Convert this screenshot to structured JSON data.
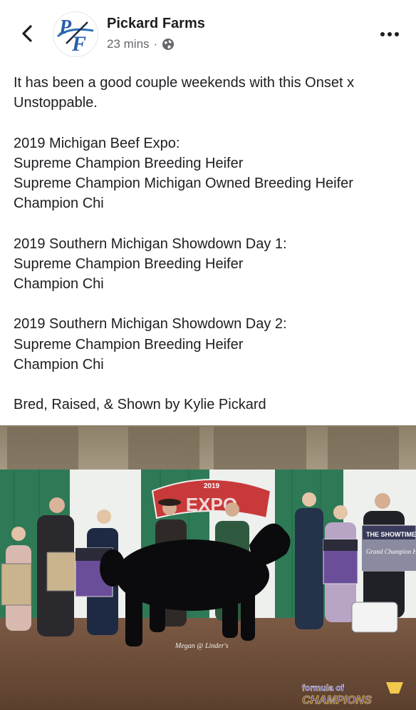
{
  "header": {
    "page_name": "Pickard Farms",
    "time_ago": "23 mins",
    "separator": "·",
    "privacy_icon": "globe-icon",
    "back_icon": "chevron-left-icon",
    "more_icon": "more-horizontal-icon",
    "logo_text": "PF"
  },
  "post": {
    "intro_line1": "It has been a good couple weekends with this Onset x",
    "intro_line2": "Unstoppable.",
    "s1_title": "2019 Michigan Beef Expo:",
    "s1_l1": "Supreme Champion Breeding Heifer",
    "s1_l2": "Supreme Champion Michigan Owned Breeding Heifer",
    "s1_l3": "Champion Chi",
    "s2_title": "2019 Southern Michigan Showdown Day 1:",
    "s2_l1": "Supreme Champion Breeding Heifer",
    "s2_l2": "Champion Chi",
    "s3_title": "2019 Southern Michigan Showdown Day 2:",
    "s3_l1": "Supreme Champion Breeding Heifer",
    "s3_l2": "Champion Chi",
    "footer": "Bred, Raised, & Shown by Kylie Pickard"
  },
  "photo": {
    "banner_year": "2019",
    "banner_text": "EXPO",
    "sign_brand": "THE SHOWTIME",
    "sign_title": "Grand Champion Heifer",
    "signature": "Megan @ Linder's",
    "watermark_top": "formula of",
    "watermark_bottom": "CHAMPIONS",
    "colors": {
      "drape_green": "#2f7a56",
      "drape_white": "#eef0ee",
      "banner_red": "#c83a3a",
      "banner_purple": "#6b4e9a"
    }
  }
}
